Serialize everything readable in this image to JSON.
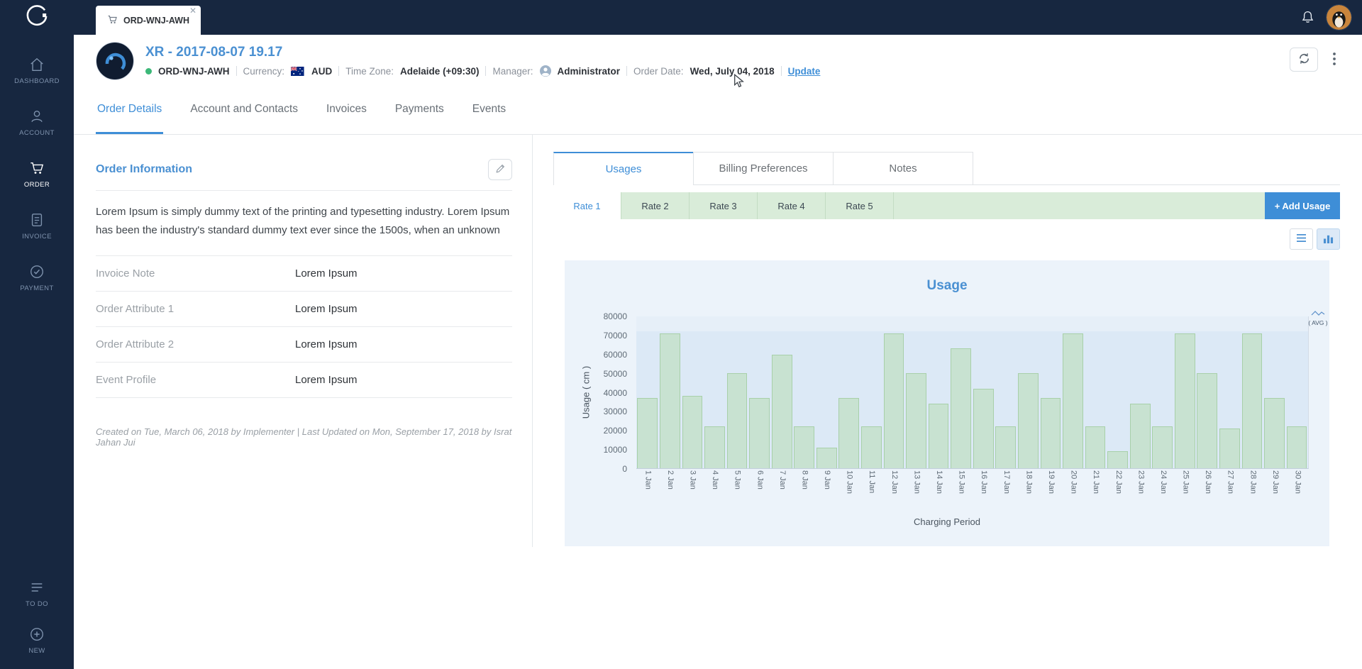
{
  "colors": {
    "navy": "#172740",
    "accent_blue": "#3e8ed7",
    "title_blue": "#4a90d2",
    "rate_bar_green": "#d9ecd9",
    "chart_bg": "#ecf3fa",
    "bar_green": "#d5e9d3",
    "status_green": "#3cb878"
  },
  "topbar": {
    "tab_label": "ORD-WNJ-AWH"
  },
  "sidebar": {
    "items": [
      {
        "label": "DASHBOARD"
      },
      {
        "label": "ACCOUNT"
      },
      {
        "label": "ORDER",
        "active": true
      },
      {
        "label": "INVOICE"
      },
      {
        "label": "PAYMENT"
      }
    ],
    "bottom_items": [
      {
        "label": "TO DO"
      },
      {
        "label": "NEW"
      }
    ]
  },
  "header": {
    "title": "XR - 2017-08-07 19.17",
    "order_code": "ORD-WNJ-AWH",
    "currency_label": "Currency:",
    "currency_value": "AUD",
    "timezone_label": "Time Zone:",
    "timezone_value": "Adelaide (+09:30)",
    "manager_label": "Manager:",
    "manager_value": "Administrator",
    "order_date_label": "Order Date:",
    "order_date_value": "Wed, July 04, 2018",
    "update_link": "Update"
  },
  "main_tabs": [
    {
      "label": "Order Details",
      "active": true
    },
    {
      "label": "Account and Contacts",
      "active": false
    },
    {
      "label": "Invoices",
      "active": false
    },
    {
      "label": "Payments",
      "active": false
    },
    {
      "label": "Events",
      "active": false
    }
  ],
  "order_info": {
    "heading": "Order Information",
    "description": "Lorem Ipsum is simply dummy text of the printing and typesetting industry. Lorem Ipsum has been the industry's standard dummy text ever since the 1500s, when an unknown",
    "fields": [
      {
        "label": "Invoice Note",
        "value": "Lorem Ipsum"
      },
      {
        "label": "Order Attribute 1",
        "value": "Lorem Ipsum"
      },
      {
        "label": "Order Attribute 2",
        "value": "Lorem Ipsum"
      },
      {
        "label": "Event Profile",
        "value": "Lorem Ipsum"
      }
    ],
    "footer": "Created on Tue, March 06, 2018 by Implementer | Last Updated on Mon, September 17, 2018 by Israt Jahan Jui"
  },
  "usage_panel": {
    "tabs": [
      {
        "label": "Usages",
        "active": true
      },
      {
        "label": "Billing Preferences",
        "active": false
      },
      {
        "label": "Notes",
        "active": false
      }
    ],
    "rates": [
      {
        "label": "Rate 1",
        "active": true
      },
      {
        "label": "Rate 2",
        "active": false
      },
      {
        "label": "Rate 3",
        "active": false
      },
      {
        "label": "Rate 4",
        "active": false
      },
      {
        "label": "Rate 5",
        "active": false
      }
    ],
    "add_usage_label": "+ Add Usage"
  },
  "chart_data": {
    "type": "bar",
    "title": "Usage",
    "xlabel": "Charging Period",
    "ylabel": "Usage ( cm )",
    "ylim": [
      0,
      80000
    ],
    "ytick_step": 10000,
    "grid": false,
    "legend": [
      "( AVG )"
    ],
    "legend_position": "top-right",
    "background_band": {
      "from": 0,
      "to": 72000
    },
    "categories": [
      "1 Jan",
      "2 Jan",
      "3 Jan",
      "4 Jan",
      "5 Jan",
      "6 Jan",
      "7 Jan",
      "8 Jan",
      "9 Jan",
      "10 Jan",
      "11 Jan",
      "12 Jan",
      "13 Jan",
      "14 Jan",
      "15 Jan",
      "16 Jan",
      "17 Jan",
      "18 Jan",
      "19 Jan",
      "20 Jan",
      "21 Jan",
      "22 Jan",
      "23 Jan",
      "24 Jan",
      "25 Jan",
      "26 Jan",
      "27 Jan",
      "28 Jan",
      "29 Jan",
      "30 Jan"
    ],
    "values": [
      37000,
      71000,
      38000,
      22000,
      50000,
      37000,
      60000,
      22000,
      11000,
      37000,
      22000,
      71000,
      50000,
      34000,
      63000,
      42000,
      22000,
      50000,
      37000,
      71000,
      22000,
      9000,
      34000,
      22000,
      71000,
      50000,
      21000,
      71000,
      37000,
      22000
    ]
  }
}
